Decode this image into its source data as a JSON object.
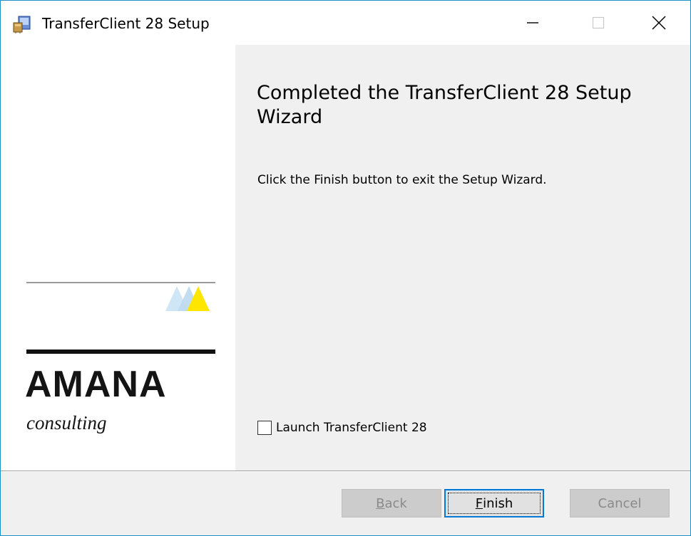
{
  "window": {
    "title": "TransferClient 28 Setup",
    "accent": "#0078d7"
  },
  "sidebar": {
    "brand_name": "AMANA",
    "brand_sub": "consulting",
    "triangle_colors": [
      "#cfe6f6",
      "#ffe600"
    ]
  },
  "main": {
    "heading": "Completed the TransferClient 28 Setup Wizard",
    "message": "Click the Finish button to exit the Setup Wizard.",
    "launch_label": "Launch TransferClient 28",
    "launch_checked": false
  },
  "footer": {
    "back": {
      "mnemonic": "B",
      "rest": "ack",
      "enabled": false
    },
    "finish": {
      "mnemonic": "F",
      "rest": "inish",
      "enabled": true,
      "focused": true
    },
    "cancel": {
      "label": "Cancel",
      "enabled": false
    }
  }
}
